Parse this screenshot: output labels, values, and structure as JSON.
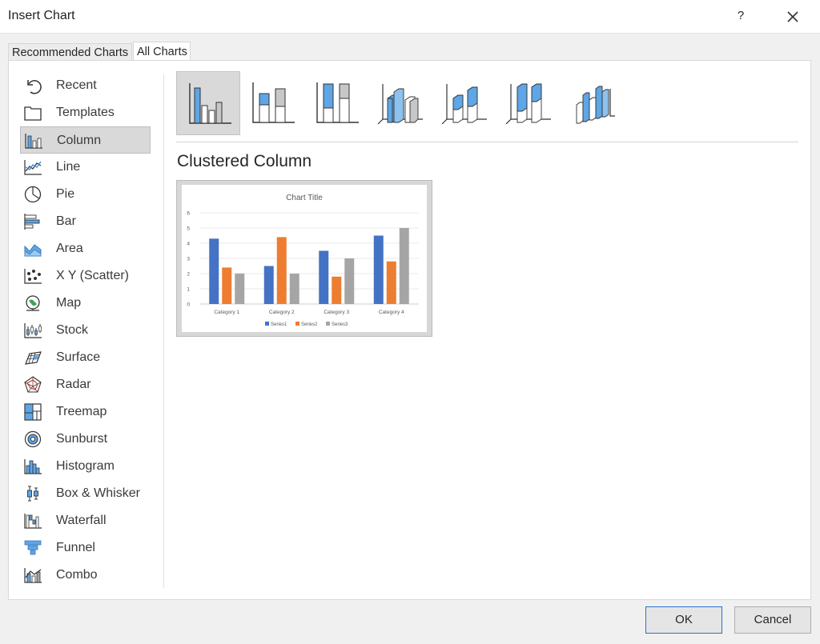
{
  "window": {
    "title": "Insert Chart",
    "help_label": "?"
  },
  "tabs": [
    {
      "label": "Recommended Charts"
    },
    {
      "label": "All Charts"
    }
  ],
  "sidebar": {
    "items": [
      {
        "label": "Recent",
        "icon": "recent-icon"
      },
      {
        "label": "Templates",
        "icon": "templates-icon"
      },
      {
        "label": "Column",
        "icon": "column-icon",
        "selected": true
      },
      {
        "label": "Line",
        "icon": "line-icon"
      },
      {
        "label": "Pie",
        "icon": "pie-icon"
      },
      {
        "label": "Bar",
        "icon": "bar-icon"
      },
      {
        "label": "Area",
        "icon": "area-icon"
      },
      {
        "label": "X Y (Scatter)",
        "icon": "scatter-icon"
      },
      {
        "label": "Map",
        "icon": "map-icon"
      },
      {
        "label": "Stock",
        "icon": "stock-icon"
      },
      {
        "label": "Surface",
        "icon": "surface-icon"
      },
      {
        "label": "Radar",
        "icon": "radar-icon"
      },
      {
        "label": "Treemap",
        "icon": "treemap-icon"
      },
      {
        "label": "Sunburst",
        "icon": "sunburst-icon"
      },
      {
        "label": "Histogram",
        "icon": "histogram-icon"
      },
      {
        "label": "Box & Whisker",
        "icon": "box-whisker-icon"
      },
      {
        "label": "Waterfall",
        "icon": "waterfall-icon"
      },
      {
        "label": "Funnel",
        "icon": "funnel-icon"
      },
      {
        "label": "Combo",
        "icon": "combo-icon"
      }
    ]
  },
  "subtypes": [
    {
      "icon": "clustered-column-icon",
      "selected": true
    },
    {
      "icon": "stacked-column-icon"
    },
    {
      "icon": "100-stacked-column-icon"
    },
    {
      "icon": "3d-clustered-column-icon"
    },
    {
      "icon": "3d-stacked-column-icon"
    },
    {
      "icon": "3d-100-stacked-column-icon"
    },
    {
      "icon": "3d-column-icon"
    }
  ],
  "selected_chart": {
    "name": "Clustered Column"
  },
  "chart_data": {
    "type": "bar",
    "title": "Chart Title",
    "categories": [
      "Category 1",
      "Category 2",
      "Category 3",
      "Category 4"
    ],
    "series": [
      {
        "name": "Series1",
        "values": [
          4.3,
          2.5,
          3.5,
          4.5
        ]
      },
      {
        "name": "Series2",
        "values": [
          2.4,
          4.4,
          1.8,
          2.8
        ]
      },
      {
        "name": "Series3",
        "values": [
          2,
          2,
          3,
          5
        ]
      }
    ],
    "ylim": [
      0,
      6
    ],
    "yticks": [
      "0",
      "1",
      "2",
      "3",
      "4",
      "5",
      "6"
    ],
    "grid": true,
    "legend": "bottom"
  },
  "colors": {
    "series1": "#4472c4",
    "series2": "#ed7d31",
    "series3": "#a5a5a5",
    "accent": "#2a72c9",
    "icon_blue": "#5ea6e6"
  },
  "buttons": {
    "ok_label": "OK",
    "cancel_label": "Cancel"
  }
}
